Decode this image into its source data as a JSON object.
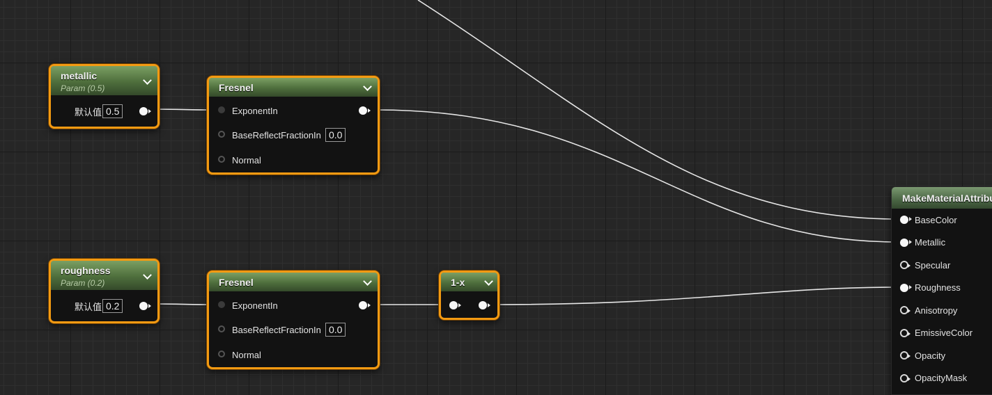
{
  "canvas": {
    "background": "#262626",
    "wire_color": "#e6e6e6",
    "selection_color": "#f39a12"
  },
  "nodes": {
    "metallic_param": {
      "title": "metallic",
      "subtitle": "Param (0.5)",
      "default_label": "默认值",
      "default_value": "0.5"
    },
    "roughness_param": {
      "title": "roughness",
      "subtitle": "Param (0.2)",
      "default_label": "默认值",
      "default_value": "0.2"
    },
    "fresnel_top": {
      "title": "Fresnel",
      "pins": {
        "exponent": "ExponentIn",
        "base_reflect": "BaseReflectFractionIn",
        "base_reflect_value": "0.0",
        "normal": "Normal"
      }
    },
    "fresnel_bottom": {
      "title": "Fresnel",
      "pins": {
        "exponent": "ExponentIn",
        "base_reflect": "BaseReflectFractionIn",
        "base_reflect_value": "0.0",
        "normal": "Normal"
      }
    },
    "one_minus": {
      "title": "1-x"
    },
    "make_material_attributes": {
      "title": "MakeMaterialAttributes",
      "inputs": [
        {
          "label": "BaseColor",
          "connected": true
        },
        {
          "label": "Metallic",
          "connected": true
        },
        {
          "label": "Specular",
          "connected": false
        },
        {
          "label": "Roughness",
          "connected": true
        },
        {
          "label": "Anisotropy",
          "connected": false
        },
        {
          "label": "EmissiveColor",
          "connected": false
        },
        {
          "label": "Opacity",
          "connected": false
        },
        {
          "label": "OpacityMask",
          "connected": false
        }
      ]
    }
  }
}
